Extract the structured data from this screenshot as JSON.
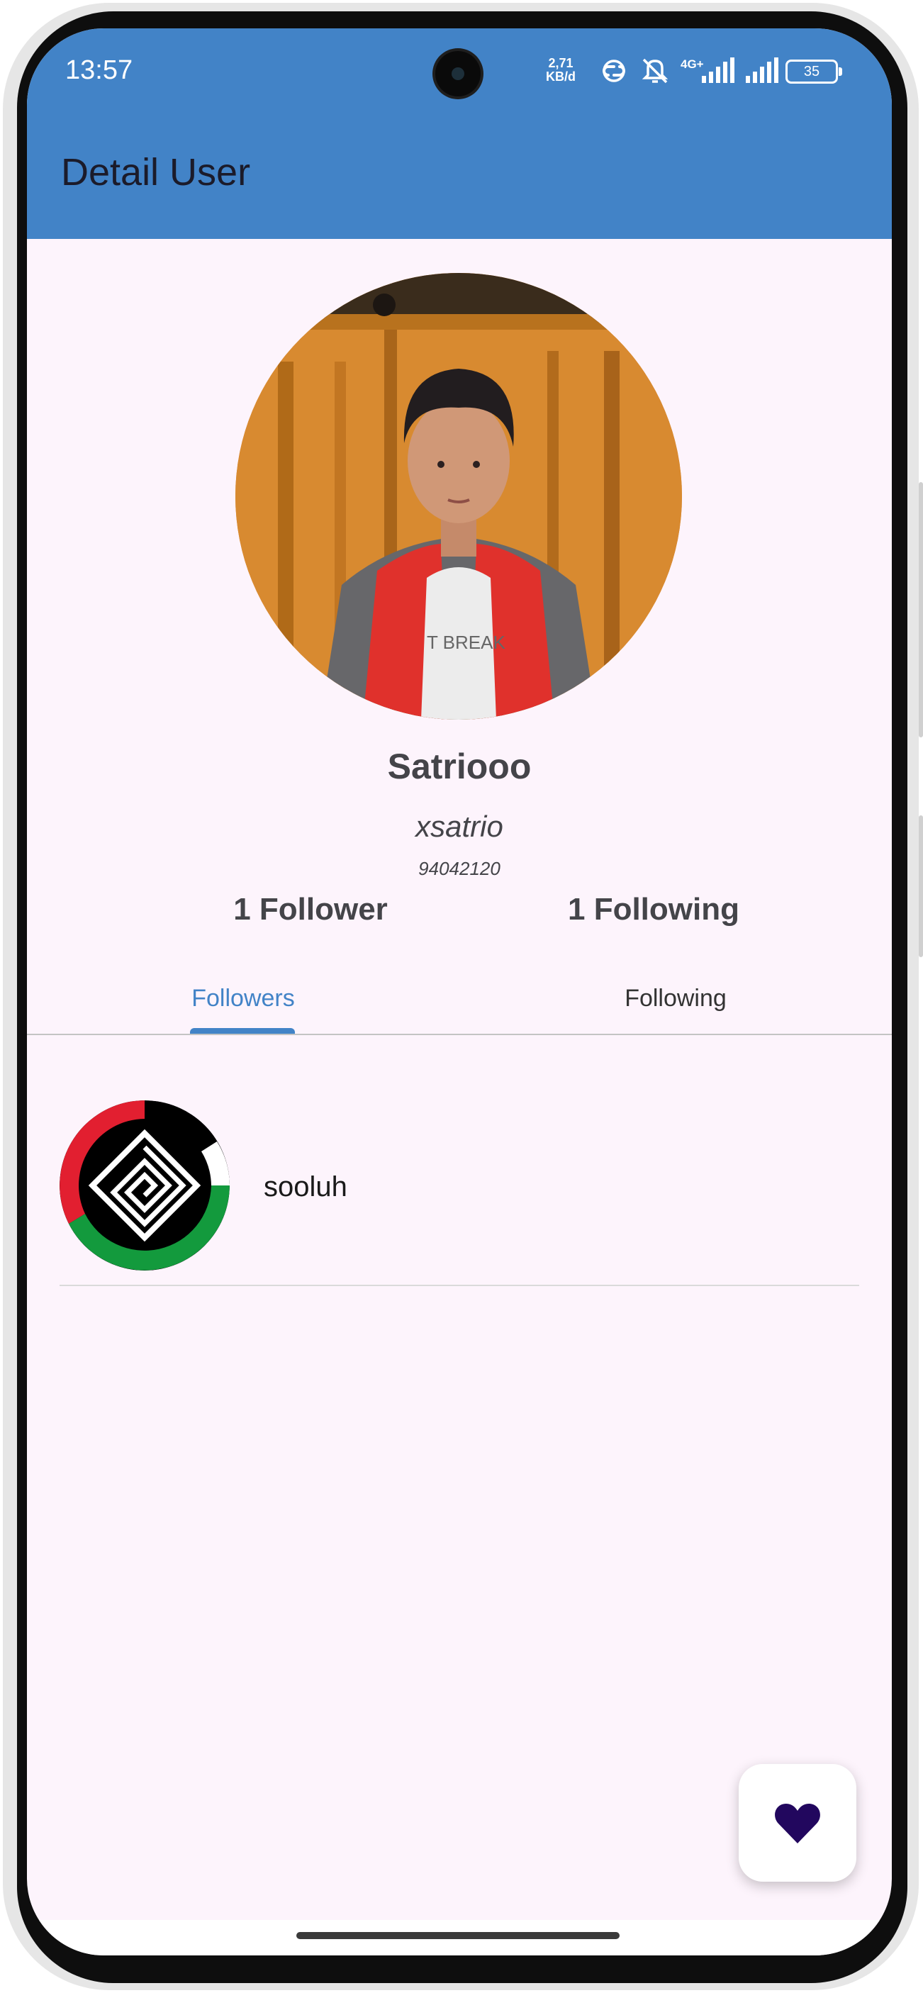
{
  "status_bar": {
    "time": "13:57",
    "net_speed_value": "2,71",
    "net_speed_unit": "KB/d",
    "network_label": "4G+",
    "battery": "35"
  },
  "app_bar": {
    "title": "Detail User"
  },
  "profile": {
    "name": "Satriooo",
    "login": "xsatrio",
    "id": "94042120",
    "followers_label": "1 Follower",
    "following_label": "1 Following"
  },
  "tabs": [
    {
      "label": "Followers",
      "selected": true
    },
    {
      "label": "Following",
      "selected": false
    }
  ],
  "followers": [
    {
      "login": "sooluh"
    }
  ],
  "fab": {
    "icon": "heart-icon",
    "color": "#22075e"
  },
  "colors": {
    "primary": "#4283c7",
    "background": "#fdf4fc",
    "text": "#444449"
  }
}
